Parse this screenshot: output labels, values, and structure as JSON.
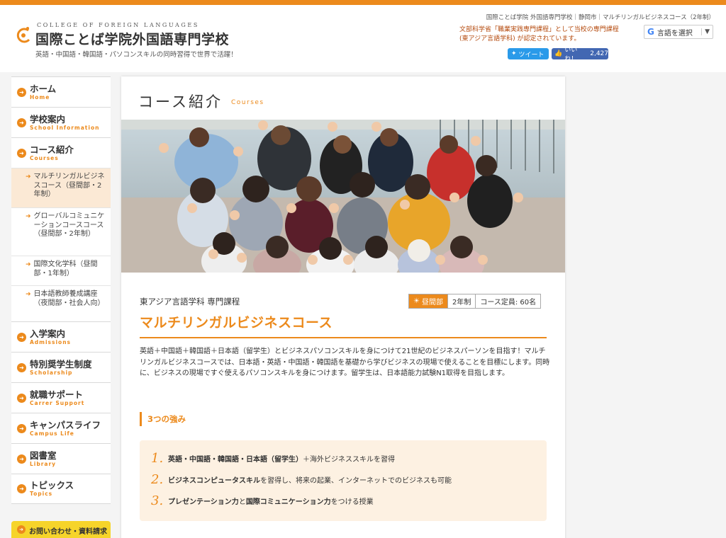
{
  "header": {
    "logo_en": "COLLEGE OF FOREIGN LANGUAGES",
    "logo_jp": "国際ことば学院外国語専門学校",
    "tagline": "英語・中国語・韓国語・パソコンスキルの同時習得で世界で活躍！",
    "breadcrumb": "国際ことば学院 外国語専門学校｜静岡市｜マルチリンガルビジネスコース（2年制）",
    "notice_line1": "文部科学省「職業実践専門課程」として当校の専門課程",
    "notice_line2": "(東アジア言語学科) が認定されています。",
    "lang_select": "言語を選択",
    "tweet": "ツイート",
    "like": "いいね！",
    "like_count": "2,427"
  },
  "sidebar": {
    "items": [
      {
        "jp": "ホーム",
        "en": "Home"
      },
      {
        "jp": "学校案内",
        "en": "School Information"
      },
      {
        "jp": "コース紹介",
        "en": "Courses"
      }
    ],
    "sub_items": [
      {
        "label": "マルチリンガルビジネスコース（昼間部・2年制）"
      },
      {
        "label": "グローバルコミュニケーションコースコース（昼間部・2年制）"
      },
      {
        "label": "国際文化学科（昼間部・1年制）"
      },
      {
        "label": "日本語教師養成講座（夜間部・社会人向）"
      }
    ],
    "items2": [
      {
        "jp": "入学案内",
        "en": "Admissions"
      },
      {
        "jp": "特別奨学生制度",
        "en": "Scholarship"
      },
      {
        "jp": "就職サポート",
        "en": "Carrer Support"
      },
      {
        "jp": "キャンパスライフ",
        "en": "Campus Life"
      },
      {
        "jp": "図書室",
        "en": "Library"
      },
      {
        "jp": "トピックス",
        "en": "Topics"
      }
    ],
    "contact": "お問い合わせ・資料請求"
  },
  "main": {
    "title": "コース紹介",
    "title_en": "Courses",
    "dept": "東アジア言語学科 専門課程",
    "tags": {
      "daytime": "昼間部",
      "years": "2年制",
      "capacity": "コース定員: 60名"
    },
    "course_title": "マルチリンガルビジネスコース",
    "intro": "英語＋中国語＋韓国語＋日本語（留学生）とビジネスパソコンスキルを身につけて21世紀のビジネスパーソンを目指す！マルチリンガルビジネスコースでは、日本語・英語・中国語・韓国語を基礎から学びビジネスの現場で使えることを目標にします。同時に、ビジネスの現場ですぐ使えるパソコンスキルを身につけます。留学生は、日本語能力試験N1取得を目指します。",
    "section_head": "3つの強み",
    "strengths": [
      {
        "num": "1.",
        "bold": "英語・中国語・韓国語・日本語（留学生）",
        "rest": "＋海外ビジネススキルを習得"
      },
      {
        "num": "2.",
        "bold": "ビジネスコンピュータスキル",
        "rest": "を習得し、将来の起業、インターネットでのビジネスも可能"
      },
      {
        "num": "3.",
        "bold": "プレゼンテーション力",
        "mid": "と",
        "bold2": "国際コミュニケーション力",
        "rest": "をつける授業"
      }
    ]
  }
}
